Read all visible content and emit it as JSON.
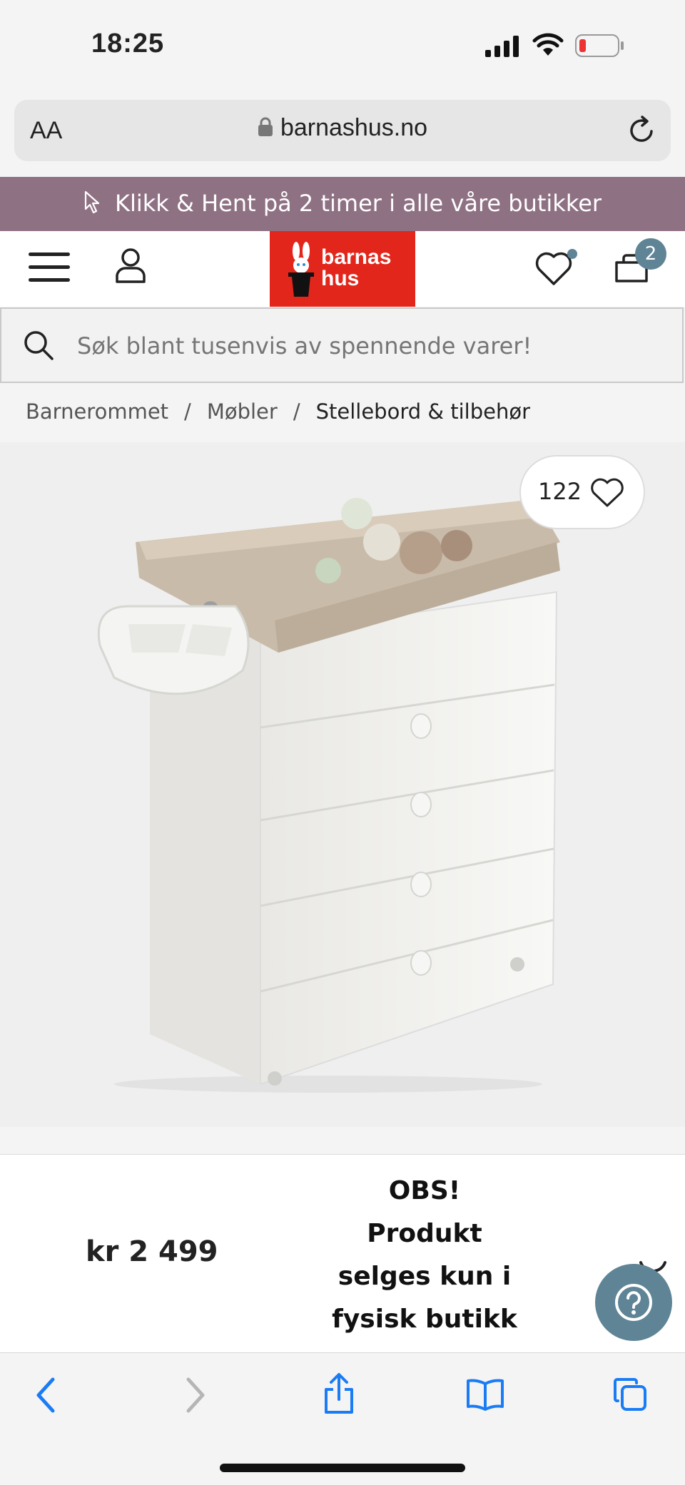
{
  "status_bar": {
    "time": "18:25"
  },
  "browser": {
    "text_size_label": "AA",
    "url": "barnashus.no"
  },
  "promo": {
    "text": "Klikk & Hent på 2 timer i alle våre butikker"
  },
  "header": {
    "logo_line1": "barnas",
    "logo_line2": "hus",
    "cart_count": "2"
  },
  "search": {
    "placeholder": "Søk blant tusenvis av spennende varer!"
  },
  "breadcrumb": {
    "items": [
      "Barnerommet",
      "Møbler",
      "Stellebord & tilbehør"
    ],
    "separator": "/"
  },
  "product": {
    "favorite_count": "122",
    "price": "kr 2 499",
    "notice_lines": [
      "OBS!",
      "Produkt",
      "selges kun i",
      "fysisk butikk"
    ]
  },
  "colors": {
    "promo_bg": "#8f7184",
    "logo_bg": "#e3261b",
    "accent": "#5e8496",
    "ios_blue": "#1a7cf5"
  },
  "icons": [
    "signal-icon",
    "wifi-icon",
    "battery-icon",
    "lock-icon",
    "reload-icon",
    "cursor-icon",
    "menu-icon",
    "user-icon",
    "heart-icon",
    "cart-icon",
    "search-icon",
    "help-icon",
    "back-icon",
    "forward-icon",
    "share-icon",
    "bookmarks-icon",
    "tabs-icon"
  ]
}
